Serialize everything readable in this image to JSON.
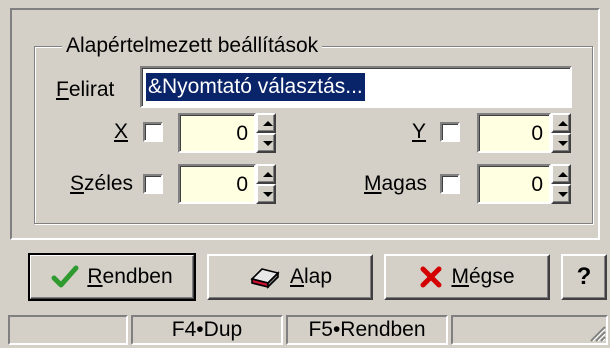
{
  "group": {
    "title": "Alapértelmezett beállítások"
  },
  "caption": {
    "label": "Felirat",
    "accel": "F",
    "rest": "elirat",
    "value": "&Nyomtató választás..."
  },
  "fields": {
    "x": {
      "accel": "X",
      "rest": "",
      "checked": false,
      "value": "0"
    },
    "y": {
      "accel": "Y",
      "rest": "",
      "checked": false,
      "value": "0"
    },
    "width": {
      "accel": "S",
      "rest": "zéles",
      "checked": false,
      "value": "0"
    },
    "height": {
      "accel": "M",
      "rest": "agas",
      "checked": false,
      "value": "0"
    }
  },
  "buttons": {
    "ok": {
      "accel": "R",
      "rest": "endben",
      "icon": "checkmark-icon",
      "color": "#2f9a2f"
    },
    "reset": {
      "accel": "A",
      "rest": "lap",
      "icon": "eraser-icon"
    },
    "cancel": {
      "accel": "M",
      "rest": "égse",
      "icon": "x-icon",
      "color": "#d40000"
    },
    "help": {
      "label": "?"
    }
  },
  "statusbar": {
    "cells": [
      "",
      "F4•Dup",
      "F5•Rendben",
      ""
    ]
  },
  "colors": {
    "face": "#d4d0c8",
    "selection": "#0a246a",
    "numeric_bg": "#ffffe1"
  }
}
